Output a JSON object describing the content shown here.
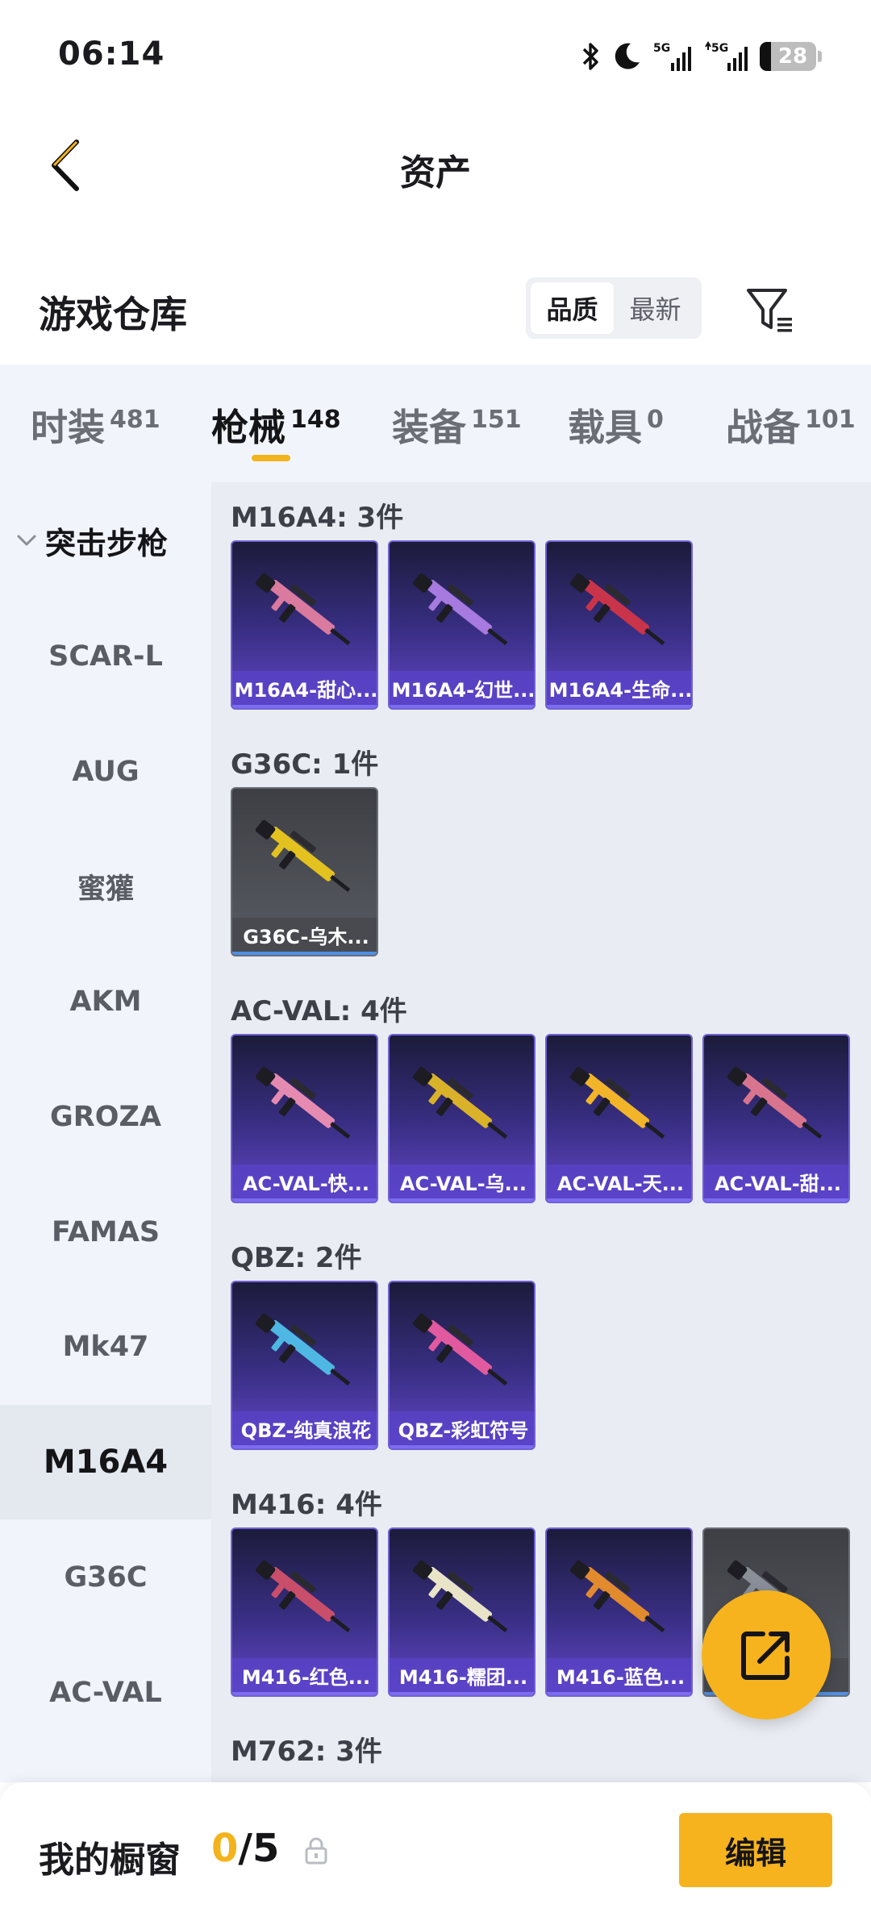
{
  "status_bar": {
    "time": "06:14",
    "battery": "28",
    "network_1": "5G",
    "network_2": "5G"
  },
  "header": {
    "title": "资产"
  },
  "warehouse": {
    "title": "游戏仓库",
    "sort_options": [
      {
        "label": "品质",
        "active": true
      },
      {
        "label": "最新",
        "active": false
      }
    ]
  },
  "tabs": [
    {
      "label": "时装",
      "count": "481",
      "active": false
    },
    {
      "label": "枪械",
      "count": "148",
      "active": true
    },
    {
      "label": "装备",
      "count": "151",
      "active": false
    },
    {
      "label": "载具",
      "count": "0",
      "active": false
    },
    {
      "label": "战备",
      "count": "101",
      "active": false
    }
  ],
  "sidebar": {
    "group_label": "突击步枪",
    "items": [
      {
        "label": "SCAR-L",
        "active": false
      },
      {
        "label": "AUG",
        "active": false
      },
      {
        "label": "蜜獾",
        "active": false
      },
      {
        "label": "AKM",
        "active": false
      },
      {
        "label": "GROZA",
        "active": false
      },
      {
        "label": "FAMAS",
        "active": false
      },
      {
        "label": "Mk47",
        "active": false
      },
      {
        "label": "M16A4",
        "active": true
      },
      {
        "label": "G36C",
        "active": false
      },
      {
        "label": "AC-VAL",
        "active": false
      }
    ]
  },
  "groups": [
    {
      "title": "M16A4: 3件",
      "items": [
        {
          "label": "M16A4-甜心...",
          "gun_color": "#d97a9e",
          "grey": false
        },
        {
          "label": "M16A4-幻世...",
          "gun_color": "#a77ae0",
          "grey": false
        },
        {
          "label": "M16A4-生命...",
          "gun_color": "#c9344a",
          "grey": false
        }
      ]
    },
    {
      "title": "G36C: 1件",
      "items": [
        {
          "label": "G36C-乌木...",
          "gun_color": "#e3c21f",
          "grey": true
        }
      ]
    },
    {
      "title": "AC-VAL: 4件",
      "items": [
        {
          "label": "AC-VAL-快...",
          "gun_color": "#e58bb2",
          "grey": false
        },
        {
          "label": "AC-VAL-乌...",
          "gun_color": "#d9b22a",
          "grey": false
        },
        {
          "label": "AC-VAL-天...",
          "gun_color": "#f2b52a",
          "grey": false
        },
        {
          "label": "AC-VAL-甜...",
          "gun_color": "#d9748f",
          "grey": false
        }
      ]
    },
    {
      "title": "QBZ: 2件",
      "items": [
        {
          "label": "QBZ-纯真浪花",
          "gun_color": "#4fb7e3",
          "grey": false
        },
        {
          "label": "QBZ-彩虹符号",
          "gun_color": "#e15aa0",
          "grey": false
        }
      ]
    },
    {
      "title": "M416: 4件",
      "items": [
        {
          "label": "M416-红色...",
          "gun_color": "#c94e6a",
          "grey": false
        },
        {
          "label": "M416-糯团...",
          "gun_color": "#e9e4c8",
          "grey": false
        },
        {
          "label": "M416-蓝色...",
          "gun_color": "#e28b2e",
          "grey": false
        },
        {
          "label": "...",
          "gun_color": "#8a8e98",
          "grey": true
        }
      ]
    },
    {
      "title": "M762: 3件",
      "items": []
    }
  ],
  "bottom_bar": {
    "label": "我的橱窗",
    "count_current": "0",
    "count_total": "/5",
    "edit_label": "编辑"
  },
  "colors": {
    "accent": "#f7b31e",
    "card_purple": "#3a2f86",
    "tab_bg": "#f1f5fb"
  }
}
